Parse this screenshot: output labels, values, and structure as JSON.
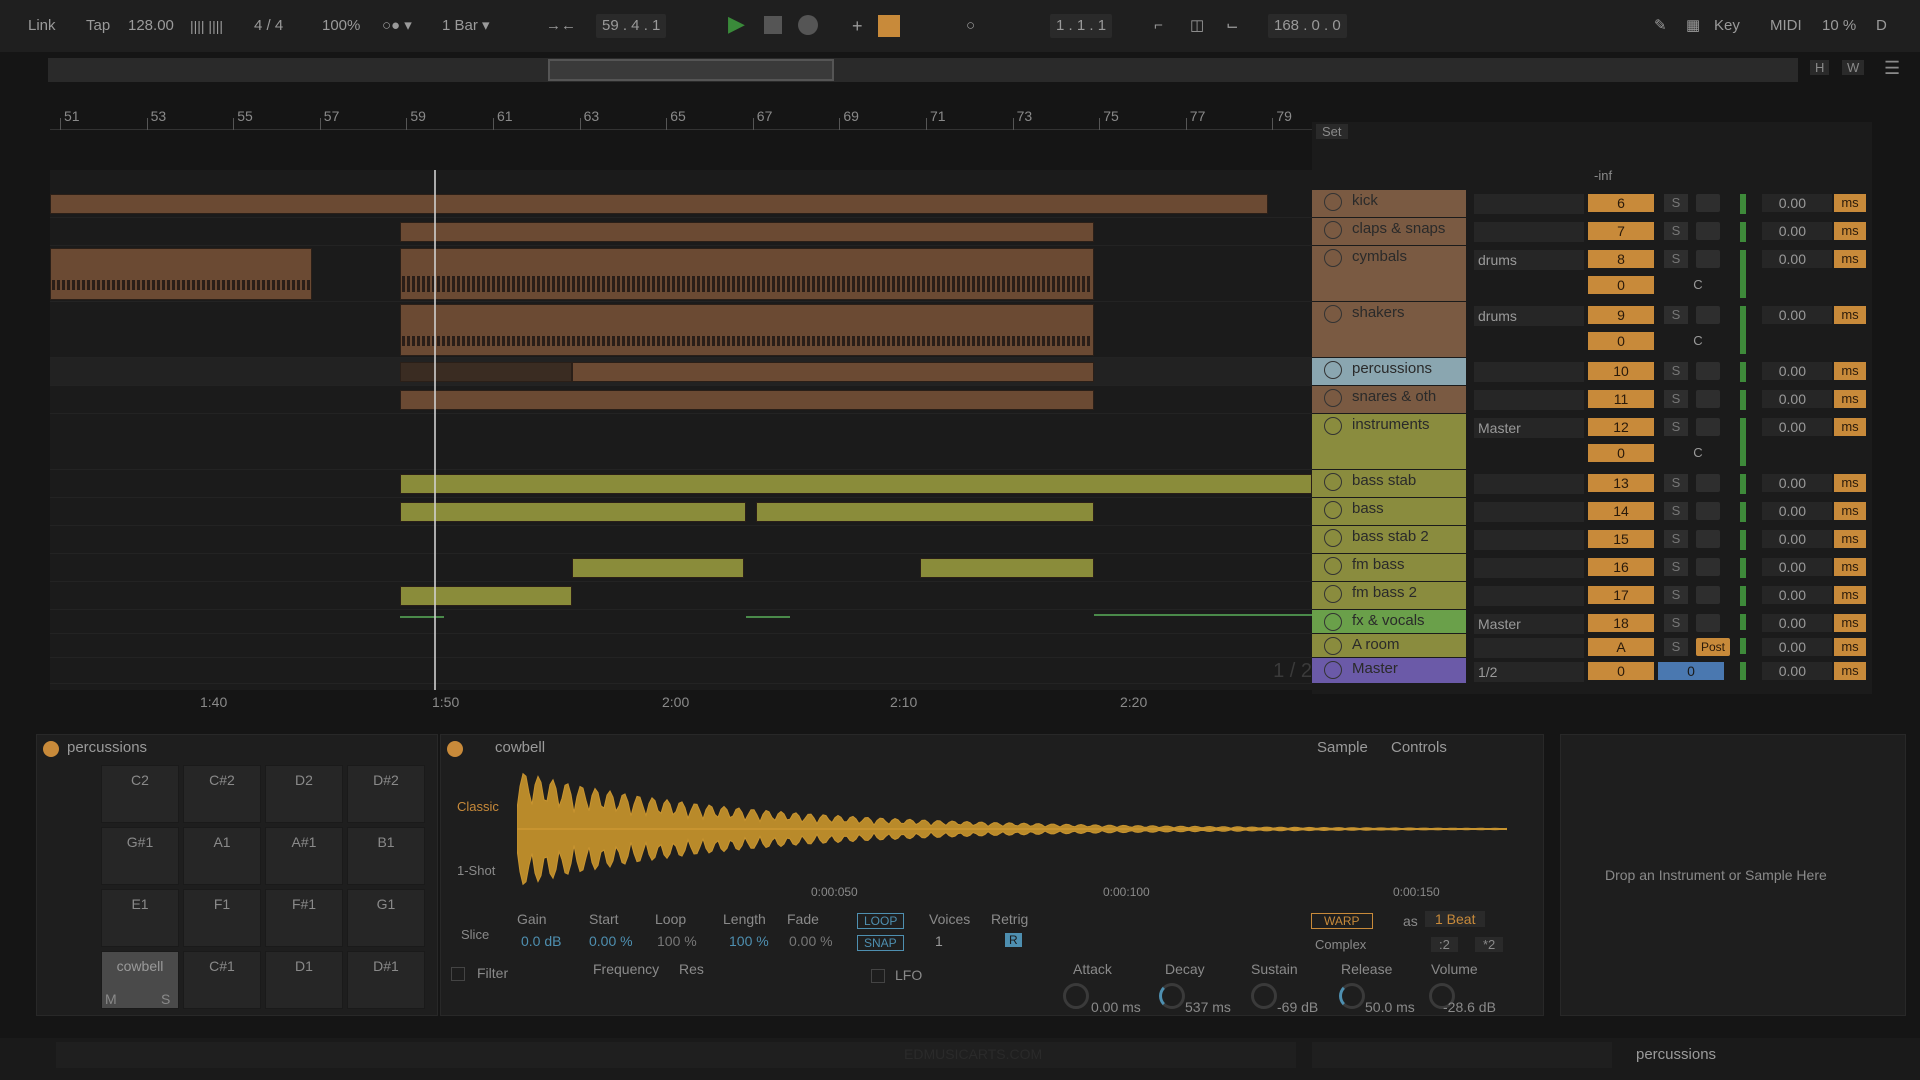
{
  "transport": {
    "link": "Link",
    "tap": "Tap",
    "tempo": "128.00",
    "time_signature": "4 / 4",
    "zoom": "100%",
    "quantize": "1 Bar",
    "position": "59 .  4 .  1",
    "loop_start": "1 .  1 .  1",
    "loop_length": "168 .  0 .  0",
    "key": "Key",
    "midi": "MIDI",
    "cpu": "10 %",
    "d": "D"
  },
  "overview": {
    "h": "H",
    "w": "W"
  },
  "ruler": {
    "bars": [
      "51",
      "53",
      "55",
      "57",
      "59",
      "61",
      "63",
      "65",
      "67",
      "69",
      "71",
      "73",
      "75",
      "77",
      "79"
    ]
  },
  "time_ruler": {
    "labels": [
      "1:40",
      "1:50",
      "2:00",
      "2:10",
      "2:20"
    ]
  },
  "arrangement": {
    "set_label": "Set",
    "page_label": "1 / 2"
  },
  "tracks": [
    {
      "name": "kick",
      "num": "6",
      "delay": "0.00",
      "color": "orange"
    },
    {
      "name": "claps & snaps",
      "num": "7",
      "delay": "0.00",
      "color": "orange"
    },
    {
      "name": "cymbals",
      "num": "8",
      "delay": "0.00",
      "route": "drums",
      "vol": "0",
      "pan": "C",
      "color": "orange"
    },
    {
      "name": "shakers",
      "num": "9",
      "delay": "0.00",
      "route": "drums",
      "vol": "0",
      "pan": "C",
      "color": "orange"
    },
    {
      "name": "percussions",
      "num": "10",
      "delay": "0.00",
      "color": "blue"
    },
    {
      "name": "snares & oth",
      "num": "11",
      "delay": "0.00",
      "color": "orange"
    },
    {
      "name": "instruments",
      "num": "12",
      "delay": "0.00",
      "route": "Master",
      "vol": "0",
      "pan": "C",
      "color": "olive"
    },
    {
      "name": "bass stab",
      "num": "13",
      "delay": "0.00",
      "color": "olive"
    },
    {
      "name": "bass",
      "num": "14",
      "delay": "0.00",
      "color": "olive"
    },
    {
      "name": "bass stab 2",
      "num": "15",
      "delay": "0.00",
      "color": "olive"
    },
    {
      "name": "fm bass",
      "num": "16",
      "delay": "0.00",
      "color": "olive"
    },
    {
      "name": "fm bass 2",
      "num": "17",
      "delay": "0.00",
      "color": "olive"
    },
    {
      "name": "fx & vocals",
      "num": "18",
      "delay": "0.00",
      "route": "Master",
      "color": "green"
    },
    {
      "name": "A room",
      "num": "A",
      "delay": "0.00",
      "post": "Post",
      "color": "bluegrey"
    },
    {
      "name": "Master",
      "num": "0",
      "num2": "0",
      "delay": "0.00",
      "route": "1/2",
      "color": "purple"
    }
  ],
  "mixer": {
    "inf": "-inf",
    "s": "S",
    "ms": "ms"
  },
  "drum_rack": {
    "title": "percussions",
    "pads": [
      "C2",
      "C#2",
      "D2",
      "D#2",
      "G#1",
      "A1",
      "A#1",
      "B1",
      "E1",
      "F1",
      "F#1",
      "G1",
      "cowbell",
      "C#1",
      "D1",
      "D#1"
    ],
    "m": "M",
    "s": "S"
  },
  "simpler": {
    "title": "cowbell",
    "tab_sample": "Sample",
    "tab_controls": "Controls",
    "modes": [
      "Classic",
      "1-Shot",
      "Slice"
    ],
    "time_marks": [
      "0:00:050",
      "0:00:100",
      "0:00:150"
    ],
    "gain_label": "Gain",
    "gain": "0.0 dB",
    "start_label": "Start",
    "start": "0.00 %",
    "loop_label": "Loop",
    "loop": "100 %",
    "length_label": "Length",
    "length": "100 %",
    "fade_label": "Fade",
    "fade": "0.00 %",
    "loop_btn": "LOOP",
    "snap_btn": "SNAP",
    "voices_label": "Voices",
    "voices": "1",
    "retrig_label": "Retrig",
    "retrig": "R",
    "warp": "WARP",
    "as": "as",
    "beats": "1 Beat",
    "warp_mode": "Complex",
    "half": ":2",
    "double": "*2",
    "filter_label": "Filter",
    "frequency_label": "Frequency",
    "res_label": "Res",
    "lfo_label": "LFO",
    "attack_label": "Attack",
    "attack": "0.00 ms",
    "decay_label": "Decay",
    "decay": "537 ms",
    "sustain_label": "Sustain",
    "sustain": "-69 dB",
    "release_label": "Release",
    "release": "50.0 ms",
    "volume_label": "Volume",
    "volume": "-28.6 dB"
  },
  "drop_zone": {
    "text": "Drop an Instrument or Sample Here"
  },
  "status": {
    "watermark": "EDMUSICARTS.COM",
    "track": "percussions"
  }
}
